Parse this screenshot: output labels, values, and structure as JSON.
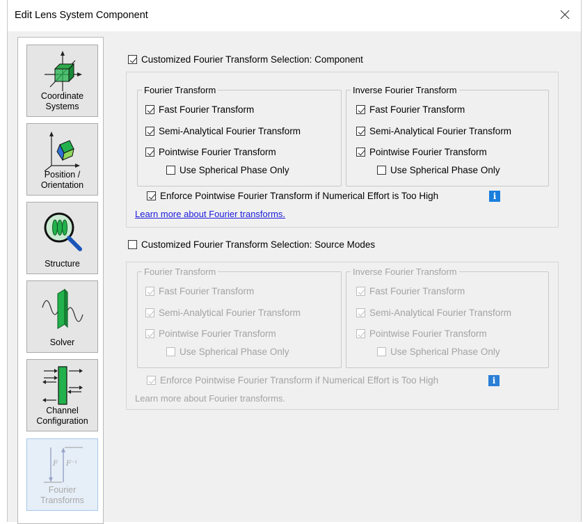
{
  "window": {
    "title": "Edit Lens System Component",
    "close_glyph": "✕"
  },
  "sidebar": {
    "items": [
      {
        "label": "Coordinate\nSystems",
        "icon": "coordinate-systems-icon"
      },
      {
        "label": "Position /\nOrientation",
        "icon": "position-orientation-icon"
      },
      {
        "label": "Structure",
        "icon": "structure-icon"
      },
      {
        "label": "Solver",
        "icon": "solver-icon"
      },
      {
        "label": "Channel\nConfiguration",
        "icon": "channel-configuration-icon"
      },
      {
        "label": "Fourier\nTransforms",
        "icon": "fourier-transforms-icon"
      }
    ]
  },
  "component": {
    "checkbox_label": "Customized Fourier Transform Selection: Component",
    "checked": true,
    "forward": {
      "legend": "Fourier Transform",
      "fast": "Fast Fourier Transform",
      "semi": "Semi-Analytical Fourier Transform",
      "pointwise": "Pointwise Fourier Transform",
      "spherical": "Use Spherical Phase Only"
    },
    "inverse": {
      "legend": "Inverse Fourier Transform",
      "fast": "Fast Fourier Transform",
      "semi": "Semi-Analytical Fourier Transform",
      "pointwise": "Pointwise Fourier Transform",
      "spherical": "Use Spherical Phase Only"
    },
    "enforce": "Enforce Pointwise Fourier Transform if Numerical Effort is Too High",
    "learn_more": "Learn more about Fourier transforms."
  },
  "source_modes": {
    "checkbox_label": "Customized Fourier Transform Selection: Source Modes",
    "checked": false,
    "forward": {
      "legend": "Fourier Transform",
      "fast": "Fast Fourier Transform",
      "semi": "Semi-Analytical Fourier Transform",
      "pointwise": "Pointwise Fourier Transform",
      "spherical": "Use Spherical Phase Only"
    },
    "inverse": {
      "legend": "Inverse Fourier Transform",
      "fast": "Fast Fourier Transform",
      "semi": "Semi-Analytical Fourier Transform",
      "pointwise": "Pointwise Fourier Transform",
      "spherical": "Use Spherical Phase Only"
    },
    "enforce": "Enforce Pointwise Fourier Transform if Numerical Effort is Too High",
    "learn_more": "Learn more about Fourier transforms."
  },
  "info_glyph": "i",
  "colors": {
    "accent": "#1a7fdc",
    "link": "#1a1adc",
    "green": "#22b14c",
    "disabled_text": "#a3a3a3"
  }
}
